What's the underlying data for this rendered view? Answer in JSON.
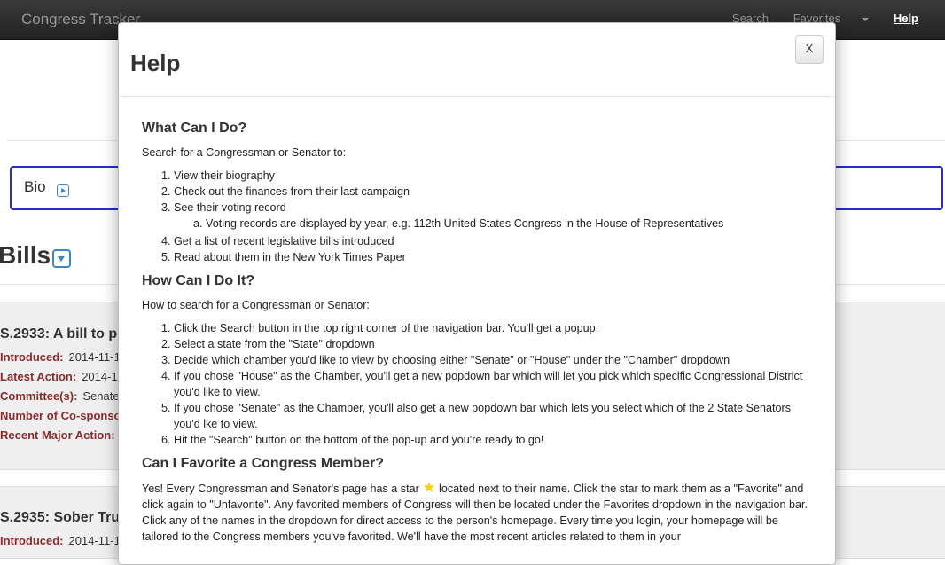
{
  "navbar": {
    "brand": "Congress Tracker",
    "search": "Search",
    "favorites": "Favorites",
    "help": "Help"
  },
  "page": {
    "bio_label": "Bio",
    "bills_title": "Bills",
    "bills": [
      {
        "title": "S.2933: A bill to pr",
        "rows": [
          {
            "k": "Introduced:",
            "v": "2014-11-1"
          },
          {
            "k": "Latest Action:",
            "v": "2014-1"
          },
          {
            "k": "Committee(s):",
            "v": "Senate"
          },
          {
            "k": "Number of Co-sponso",
            "v": ""
          },
          {
            "k": "Recent Major Action:",
            "v": ""
          }
        ]
      },
      {
        "title": "S.2935: Sober Tru",
        "rows": [
          {
            "k": "Introduced:",
            "v": "2014-11-1"
          }
        ]
      }
    ]
  },
  "modal": {
    "title": "Help",
    "close_label": "X",
    "sections": {
      "what": {
        "heading": "What Can I Do?",
        "intro": "Search for a Congressman or Senator to:",
        "items": [
          "View their biography",
          "Check out the finances from their last campaign",
          "See their voting record",
          "Get a list of recent legislative bills introduced",
          "Read about them in the New York Times Paper"
        ],
        "subitem": "Voting records are displayed by year, e.g. 112th United States Congress in the House of Representatives"
      },
      "how": {
        "heading": "How Can I Do It?",
        "intro": "How to search for a Congressman or Senator:",
        "items": [
          "Click the Search button in the top right corner of the navigation bar. You'll get a popup.",
          "Select a state from the \"State\" dropdown",
          "Decide which chamber you'd like to view by choosing either \"Senate\" or \"House\" under the \"Chamber\" dropdown",
          "If you chose \"House\" as the Chamber, you'll get a new popdown bar which will let you pick which specific Congressional District you'd like to view.",
          "If you chose \"Senate\" as the Chamber, you'll also get a new popdown bar which lets you select which of the 2 State Senators you'd lke to view.",
          "Hit the \"Search\" button on the bottom of the pop-up and you're ready to go!"
        ]
      },
      "fav": {
        "heading": "Can I Favorite a Congress Member?",
        "text_before": "Yes! Every Congressman and Senator's page has a star ",
        "text_after": " located next to their name. Click the star to mark them as a \"Favorite\" and click again to \"Unfavorite\". Any favorited members of Congress will then be located under the Favorites dropdown in the navigation bar. Click any of the names in the dropdown for direct access to the person's homepage. Every time you login, your homepage will be tailored to the Congress members you've favorited. We'll have the most recent articles related to them in your"
      }
    }
  }
}
